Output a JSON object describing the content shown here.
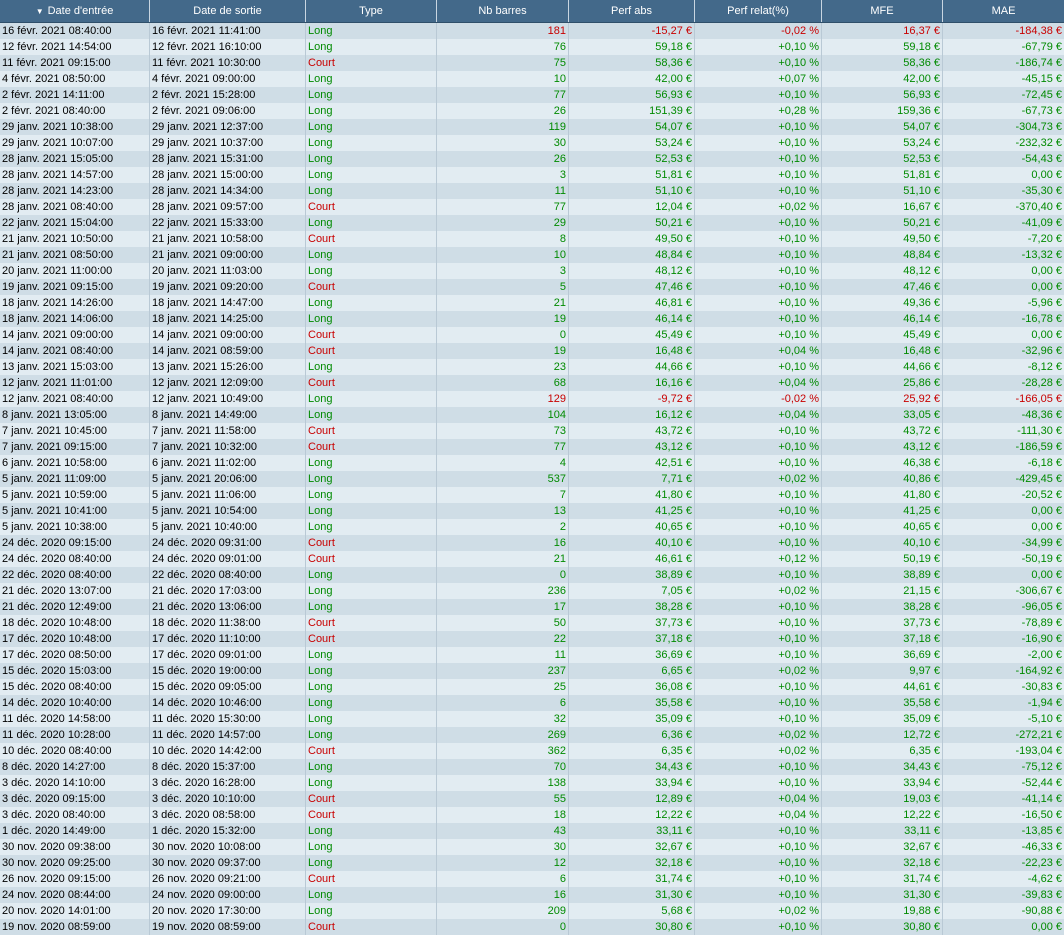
{
  "columns": [
    "Date d'entrée",
    "Date de sortie",
    "Type",
    "Nb barres",
    "Perf abs",
    "Perf relat(%)",
    "MFE",
    "MAE"
  ],
  "sort_column": "Date d'entrée",
  "colors": {
    "positive": "#008a00",
    "negative": "#c80000",
    "header_bg": "#43698a"
  },
  "rows": [
    [
      "16 févr. 2021 08:40:00",
      "16 févr. 2021 11:41:00",
      "Long",
      "181",
      "-15,27 €",
      "-0,02 %",
      "16,37 €",
      "-184,38 €"
    ],
    [
      "12 févr. 2021 14:54:00",
      "12 févr. 2021 16:10:00",
      "Long",
      "76",
      "59,18 €",
      "+0,10 %",
      "59,18 €",
      "-67,79 €"
    ],
    [
      "11 févr. 2021 09:15:00",
      "11 févr. 2021 10:30:00",
      "Court",
      "75",
      "58,36 €",
      "+0,10 %",
      "58,36 €",
      "-186,74 €"
    ],
    [
      "4 févr. 2021 08:50:00",
      "4 févr. 2021 09:00:00",
      "Long",
      "10",
      "42,00 €",
      "+0,07 %",
      "42,00 €",
      "-45,15 €"
    ],
    [
      "2 févr. 2021 14:11:00",
      "2 févr. 2021 15:28:00",
      "Long",
      "77",
      "56,93 €",
      "+0,10 %",
      "56,93 €",
      "-72,45 €"
    ],
    [
      "2 févr. 2021 08:40:00",
      "2 févr. 2021 09:06:00",
      "Long",
      "26",
      "151,39 €",
      "+0,28 %",
      "159,36 €",
      "-67,73 €"
    ],
    [
      "29 janv. 2021 10:38:00",
      "29 janv. 2021 12:37:00",
      "Long",
      "119",
      "54,07 €",
      "+0,10 %",
      "54,07 €",
      "-304,73 €"
    ],
    [
      "29 janv. 2021 10:07:00",
      "29 janv. 2021 10:37:00",
      "Long",
      "30",
      "53,24 €",
      "+0,10 %",
      "53,24 €",
      "-232,32 €"
    ],
    [
      "28 janv. 2021 15:05:00",
      "28 janv. 2021 15:31:00",
      "Long",
      "26",
      "52,53 €",
      "+0,10 %",
      "52,53 €",
      "-54,43 €"
    ],
    [
      "28 janv. 2021 14:57:00",
      "28 janv. 2021 15:00:00",
      "Long",
      "3",
      "51,81 €",
      "+0,10 %",
      "51,81 €",
      "0,00 €"
    ],
    [
      "28 janv. 2021 14:23:00",
      "28 janv. 2021 14:34:00",
      "Long",
      "11",
      "51,10 €",
      "+0,10 %",
      "51,10 €",
      "-35,30 €"
    ],
    [
      "28 janv. 2021 08:40:00",
      "28 janv. 2021 09:57:00",
      "Court",
      "77",
      "12,04 €",
      "+0,02 %",
      "16,67 €",
      "-370,40 €"
    ],
    [
      "22 janv. 2021 15:04:00",
      "22 janv. 2021 15:33:00",
      "Long",
      "29",
      "50,21 €",
      "+0,10 %",
      "50,21 €",
      "-41,09 €"
    ],
    [
      "21 janv. 2021 10:50:00",
      "21 janv. 2021 10:58:00",
      "Court",
      "8",
      "49,50 €",
      "+0,10 %",
      "49,50 €",
      "-7,20 €"
    ],
    [
      "21 janv. 2021 08:50:00",
      "21 janv. 2021 09:00:00",
      "Long",
      "10",
      "48,84 €",
      "+0,10 %",
      "48,84 €",
      "-13,32 €"
    ],
    [
      "20 janv. 2021 11:00:00",
      "20 janv. 2021 11:03:00",
      "Long",
      "3",
      "48,12 €",
      "+0,10 %",
      "48,12 €",
      "0,00 €"
    ],
    [
      "19 janv. 2021 09:15:00",
      "19 janv. 2021 09:20:00",
      "Court",
      "5",
      "47,46 €",
      "+0,10 %",
      "47,46 €",
      "0,00 €"
    ],
    [
      "18 janv. 2021 14:26:00",
      "18 janv. 2021 14:47:00",
      "Long",
      "21",
      "46,81 €",
      "+0,10 %",
      "49,36 €",
      "-5,96 €"
    ],
    [
      "18 janv. 2021 14:06:00",
      "18 janv. 2021 14:25:00",
      "Long",
      "19",
      "46,14 €",
      "+0,10 %",
      "46,14 €",
      "-16,78 €"
    ],
    [
      "14 janv. 2021 09:00:00",
      "14 janv. 2021 09:00:00",
      "Court",
      "0",
      "45,49 €",
      "+0,10 %",
      "45,49 €",
      "0,00 €"
    ],
    [
      "14 janv. 2021 08:40:00",
      "14 janv. 2021 08:59:00",
      "Court",
      "19",
      "16,48 €",
      "+0,04 %",
      "16,48 €",
      "-32,96 €"
    ],
    [
      "13 janv. 2021 15:03:00",
      "13 janv. 2021 15:26:00",
      "Long",
      "23",
      "44,66 €",
      "+0,10 %",
      "44,66 €",
      "-8,12 €"
    ],
    [
      "12 janv. 2021 11:01:00",
      "12 janv. 2021 12:09:00",
      "Court",
      "68",
      "16,16 €",
      "+0,04 %",
      "25,86 €",
      "-28,28 €"
    ],
    [
      "12 janv. 2021 08:40:00",
      "12 janv. 2021 10:49:00",
      "Long",
      "129",
      "-9,72 €",
      "-0,02 %",
      "25,92 €",
      "-166,05 €"
    ],
    [
      "8 janv. 2021 13:05:00",
      "8 janv. 2021 14:49:00",
      "Long",
      "104",
      "16,12 €",
      "+0,04 %",
      "33,05 €",
      "-48,36 €"
    ],
    [
      "7 janv. 2021 10:45:00",
      "7 janv. 2021 11:58:00",
      "Court",
      "73",
      "43,72 €",
      "+0,10 %",
      "43,72 €",
      "-111,30 €"
    ],
    [
      "7 janv. 2021 09:15:00",
      "7 janv. 2021 10:32:00",
      "Court",
      "77",
      "43,12 €",
      "+0,10 %",
      "43,12 €",
      "-186,59 €"
    ],
    [
      "6 janv. 2021 10:58:00",
      "6 janv. 2021 11:02:00",
      "Long",
      "4",
      "42,51 €",
      "+0,10 %",
      "46,38 €",
      "-6,18 €"
    ],
    [
      "5 janv. 2021 11:09:00",
      "5 janv. 2021 20:06:00",
      "Long",
      "537",
      "7,71 €",
      "+0,02 %",
      "40,86 €",
      "-429,45 €"
    ],
    [
      "5 janv. 2021 10:59:00",
      "5 janv. 2021 11:06:00",
      "Long",
      "7",
      "41,80 €",
      "+0,10 %",
      "41,80 €",
      "-20,52 €"
    ],
    [
      "5 janv. 2021 10:41:00",
      "5 janv. 2021 10:54:00",
      "Long",
      "13",
      "41,25 €",
      "+0,10 %",
      "41,25 €",
      "0,00 €"
    ],
    [
      "5 janv. 2021 10:38:00",
      "5 janv. 2021 10:40:00",
      "Long",
      "2",
      "40,65 €",
      "+0,10 %",
      "40,65 €",
      "0,00 €"
    ],
    [
      "24 déc. 2020 09:15:00",
      "24 déc. 2020 09:31:00",
      "Court",
      "16",
      "40,10 €",
      "+0,10 %",
      "40,10 €",
      "-34,99 €"
    ],
    [
      "24 déc. 2020 08:40:00",
      "24 déc. 2020 09:01:00",
      "Court",
      "21",
      "46,61 €",
      "+0,12 %",
      "50,19 €",
      "-50,19 €"
    ],
    [
      "22 déc. 2020 08:40:00",
      "22 déc. 2020 08:40:00",
      "Long",
      "0",
      "38,89 €",
      "+0,10 %",
      "38,89 €",
      "0,00 €"
    ],
    [
      "21 déc. 2020 13:07:00",
      "21 déc. 2020 17:03:00",
      "Long",
      "236",
      "7,05 €",
      "+0,02 %",
      "21,15 €",
      "-306,67 €"
    ],
    [
      "21 déc. 2020 12:49:00",
      "21 déc. 2020 13:06:00",
      "Long",
      "17",
      "38,28 €",
      "+0,10 %",
      "38,28 €",
      "-96,05 €"
    ],
    [
      "18 déc. 2020 10:48:00",
      "18 déc. 2020 11:38:00",
      "Court",
      "50",
      "37,73 €",
      "+0,10 %",
      "37,73 €",
      "-78,89 €"
    ],
    [
      "17 déc. 2020 10:48:00",
      "17 déc. 2020 11:10:00",
      "Court",
      "22",
      "37,18 €",
      "+0,10 %",
      "37,18 €",
      "-16,90 €"
    ],
    [
      "17 déc. 2020 08:50:00",
      "17 déc. 2020 09:01:00",
      "Long",
      "11",
      "36,69 €",
      "+0,10 %",
      "36,69 €",
      "-2,00 €"
    ],
    [
      "15 déc. 2020 15:03:00",
      "15 déc. 2020 19:00:00",
      "Long",
      "237",
      "6,65 €",
      "+0,02 %",
      "9,97 €",
      "-164,92 €"
    ],
    [
      "15 déc. 2020 08:40:00",
      "15 déc. 2020 09:05:00",
      "Long",
      "25",
      "36,08 €",
      "+0,10 %",
      "44,61 €",
      "-30,83 €"
    ],
    [
      "14 déc. 2020 10:40:00",
      "14 déc. 2020 10:46:00",
      "Long",
      "6",
      "35,58 €",
      "+0,10 %",
      "35,58 €",
      "-1,94 €"
    ],
    [
      "11 déc. 2020 14:58:00",
      "11 déc. 2020 15:30:00",
      "Long",
      "32",
      "35,09 €",
      "+0,10 %",
      "35,09 €",
      "-5,10 €"
    ],
    [
      "11 déc. 2020 10:28:00",
      "11 déc. 2020 14:57:00",
      "Long",
      "269",
      "6,36 €",
      "+0,02 %",
      "12,72 €",
      "-272,21 €"
    ],
    [
      "10 déc. 2020 08:40:00",
      "10 déc. 2020 14:42:00",
      "Court",
      "362",
      "6,35 €",
      "+0,02 %",
      "6,35 €",
      "-193,04 €"
    ],
    [
      "8 déc. 2020 14:27:00",
      "8 déc. 2020 15:37:00",
      "Long",
      "70",
      "34,43 €",
      "+0,10 %",
      "34,43 €",
      "-75,12 €"
    ],
    [
      "3 déc. 2020 14:10:00",
      "3 déc. 2020 16:28:00",
      "Long",
      "138",
      "33,94 €",
      "+0,10 %",
      "33,94 €",
      "-52,44 €"
    ],
    [
      "3 déc. 2020 09:15:00",
      "3 déc. 2020 10:10:00",
      "Court",
      "55",
      "12,89 €",
      "+0,04 %",
      "19,03 €",
      "-41,14 €"
    ],
    [
      "3 déc. 2020 08:40:00",
      "3 déc. 2020 08:58:00",
      "Court",
      "18",
      "12,22 €",
      "+0,04 %",
      "12,22 €",
      "-16,50 €"
    ],
    [
      "1 déc. 2020 14:49:00",
      "1 déc. 2020 15:32:00",
      "Long",
      "43",
      "33,11 €",
      "+0,10 %",
      "33,11 €",
      "-13,85 €"
    ],
    [
      "30 nov. 2020 09:38:00",
      "30 nov. 2020 10:08:00",
      "Long",
      "30",
      "32,67 €",
      "+0,10 %",
      "32,67 €",
      "-46,33 €"
    ],
    [
      "30 nov. 2020 09:25:00",
      "30 nov. 2020 09:37:00",
      "Long",
      "12",
      "32,18 €",
      "+0,10 %",
      "32,18 €",
      "-22,23 €"
    ],
    [
      "26 nov. 2020 09:15:00",
      "26 nov. 2020 09:21:00",
      "Court",
      "6",
      "31,74 €",
      "+0,10 %",
      "31,74 €",
      "-4,62 €"
    ],
    [
      "24 nov. 2020 08:44:00",
      "24 nov. 2020 09:00:00",
      "Long",
      "16",
      "31,30 €",
      "+0,10 %",
      "31,30 €",
      "-39,83 €"
    ],
    [
      "20 nov. 2020 14:01:00",
      "20 nov. 2020 17:30:00",
      "Long",
      "209",
      "5,68 €",
      "+0,02 %",
      "19,88 €",
      "-90,88 €"
    ],
    [
      "19 nov. 2020 08:59:00",
      "19 nov. 2020 08:59:00",
      "Court",
      "0",
      "30,80 €",
      "+0,10 %",
      "30,80 €",
      "0,00 €"
    ]
  ]
}
